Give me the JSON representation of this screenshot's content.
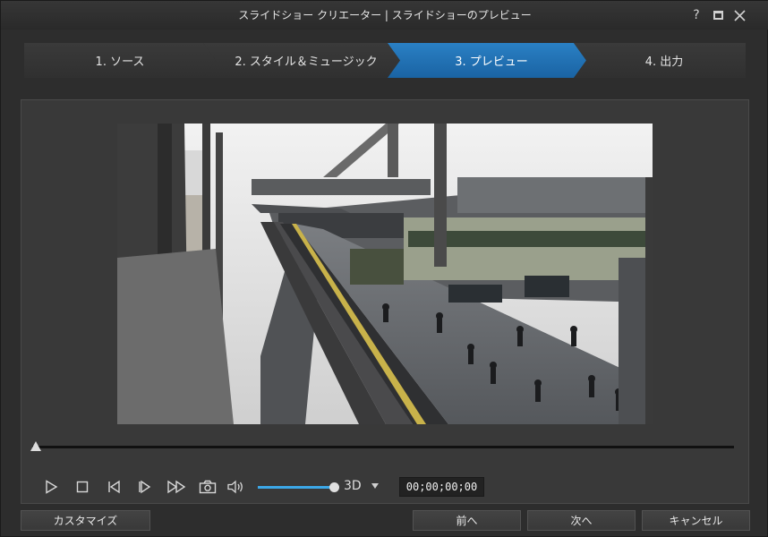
{
  "window": {
    "title": "スライドショー クリエーター | スライドショーのプレビュー"
  },
  "steps": [
    {
      "label": "1. ソース",
      "active": false
    },
    {
      "label": "2. スタイル＆ミュージック",
      "active": false
    },
    {
      "label": "3. プレビュー",
      "active": true
    },
    {
      "label": "4. 出力",
      "active": false
    }
  ],
  "player": {
    "mode_3d_label": "3D",
    "timecode": "00;00;00;00",
    "seek_position": 0,
    "volume": 0.92,
    "accent_color": "#3ca8e8"
  },
  "icons": [
    "help-icon",
    "maximize-icon",
    "close-icon",
    "play-icon",
    "stop-icon",
    "previous-frame-icon",
    "next-frame-icon",
    "fast-forward-icon",
    "snapshot-camera-icon",
    "volume-icon",
    "dropdown-arrow-icon"
  ],
  "footer": {
    "customize_label": "カスタマイズ",
    "prev_label": "前へ",
    "next_label": "次へ",
    "cancel_label": "キャンセル"
  }
}
